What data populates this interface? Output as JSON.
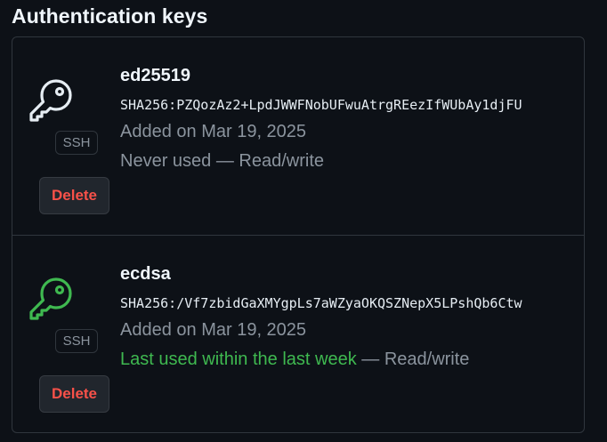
{
  "heading": "Authentication keys",
  "colors": {
    "background": "#0d1117",
    "border": "#30363d",
    "muted": "#8b949e",
    "danger": "#f85149",
    "success": "#3fb950",
    "key_icon_default": "#e6edf3",
    "key_icon_recent": "#3fb950"
  },
  "keys": [
    {
      "title": "ed25519",
      "fingerprint": "SHA256:PZQozAz2+LpdJWWFNobUFwuAtrgREezIfWUbAy1djFU",
      "added": "Added on Mar 19, 2025",
      "last_used": "Never used",
      "separator": " — ",
      "access": "Read/write",
      "type_badge": "SSH",
      "delete_label": "Delete",
      "icon": "key-icon"
    },
    {
      "title": "ecdsa",
      "fingerprint": "SHA256:/Vf7zbidGaXMYgpLs7aWZyaOKQSZNepX5LPshQb6Ctw",
      "added": "Added on Mar 19, 2025",
      "last_used": "Last used within the last week",
      "separator": " — ",
      "access": "Read/write",
      "type_badge": "SSH",
      "delete_label": "Delete",
      "icon": "key-icon"
    }
  ]
}
